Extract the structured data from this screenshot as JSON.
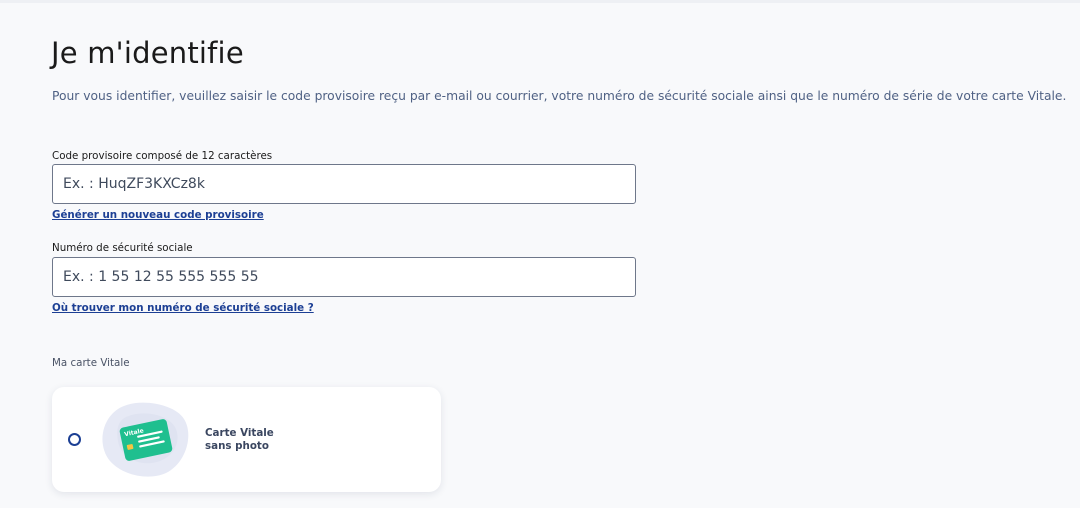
{
  "page": {
    "title": "Je m'identifie",
    "intro": "Pour vous identifier, veuillez saisir le code provisoire reçu par e-mail ou courrier, votre numéro de sécurité sociale ainsi que le numéro de série de votre carte Vitale."
  },
  "code_field": {
    "label": "Code provisoire composé de 12 caractères",
    "placeholder": "Ex. : HuqZF3KXCz8k",
    "value": "",
    "link": "Générer un nouveau code provisoire"
  },
  "nss_field": {
    "label": "Numéro de sécurité sociale",
    "placeholder": "Ex. : 1 55 12 55 555 555 55",
    "value": "",
    "link": "Où trouver mon numéro de sécurité sociale ?"
  },
  "vitale": {
    "section_label": "Ma carte Vitale",
    "options": [
      {
        "line1": "Carte Vitale",
        "line2": "sans photo",
        "card_tag": "Vitale",
        "selected": false,
        "icon": "vitale-card-icon"
      }
    ]
  },
  "colors": {
    "link": "#1c3f94",
    "intro_text": "#4f6184",
    "card_green": "#1fbf8f",
    "card_blob": "#e6e9f5"
  }
}
